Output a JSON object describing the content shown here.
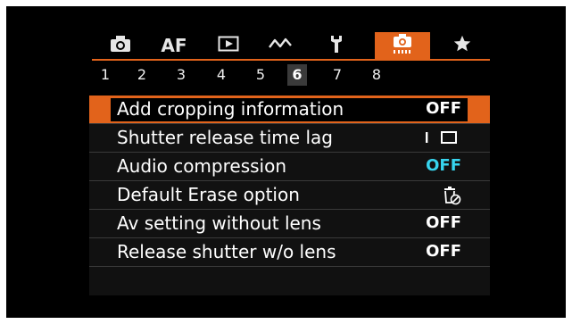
{
  "tabs": [
    {
      "name": "camera-icon",
      "label": "",
      "active": false
    },
    {
      "name": "af-tab",
      "label": "AF",
      "active": false
    },
    {
      "name": "play-icon",
      "label": "",
      "active": false
    },
    {
      "name": "wireless-icon",
      "label": "",
      "active": false
    },
    {
      "name": "wrench-icon",
      "label": "",
      "active": false
    },
    {
      "name": "custom-shooting-icon",
      "label": "",
      "active": true
    },
    {
      "name": "star-icon",
      "label": "",
      "active": false
    }
  ],
  "pages": [
    "1",
    "2",
    "3",
    "4",
    "5",
    "6",
    "7",
    "8"
  ],
  "active_page": "6",
  "menu": {
    "items": [
      {
        "label": "Add cropping information",
        "value": "OFF"
      },
      {
        "label": "Shutter release time lag",
        "value": ""
      },
      {
        "label": "Audio compression",
        "value": "OFF"
      },
      {
        "label": "Default Erase option",
        "value": ""
      },
      {
        "label": "Av setting without lens",
        "value": "OFF"
      },
      {
        "label": "Release shutter w/o lens",
        "value": "OFF"
      }
    ]
  },
  "colors": {
    "accent": "#e2631b",
    "cyan": "#37d4ee"
  }
}
